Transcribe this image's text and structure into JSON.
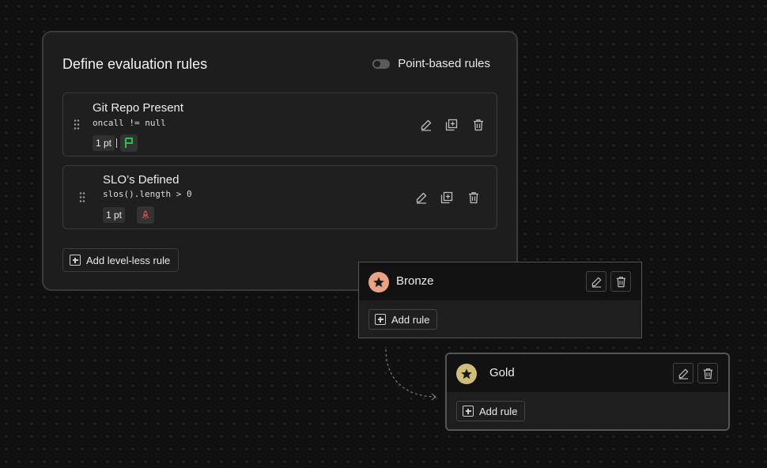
{
  "panel": {
    "title": "Define evaluation rules",
    "toggle": {
      "label": "Point-based rules",
      "on": false
    }
  },
  "rules": [
    {
      "name": "Git Repo Present",
      "expression": "oncall != null",
      "points": "1 pt",
      "level_icon": "green-flag-icon",
      "level_color": "#2fbf4f"
    },
    {
      "name": "SLO’s Defined",
      "expression": "slos().length > 0",
      "points": "1 pt",
      "level_icon": "red-rocket-icon",
      "level_color": "#c94a3a"
    }
  ],
  "add_levelless_label": "Add level-less rule",
  "levels": [
    {
      "name": "Bronze",
      "medal_color": "#e8a285",
      "add_rule_label": "Add rule"
    },
    {
      "name": "Gold",
      "medal_color": "#cdbf7a",
      "add_rule_label": "Add rule"
    }
  ],
  "icons": {
    "edit": "pencil-icon",
    "duplicate": "duplicate-icon",
    "delete": "trash-icon",
    "drag": "drag-handle-icon",
    "star": "star-icon",
    "plus": "plus-box-icon"
  }
}
